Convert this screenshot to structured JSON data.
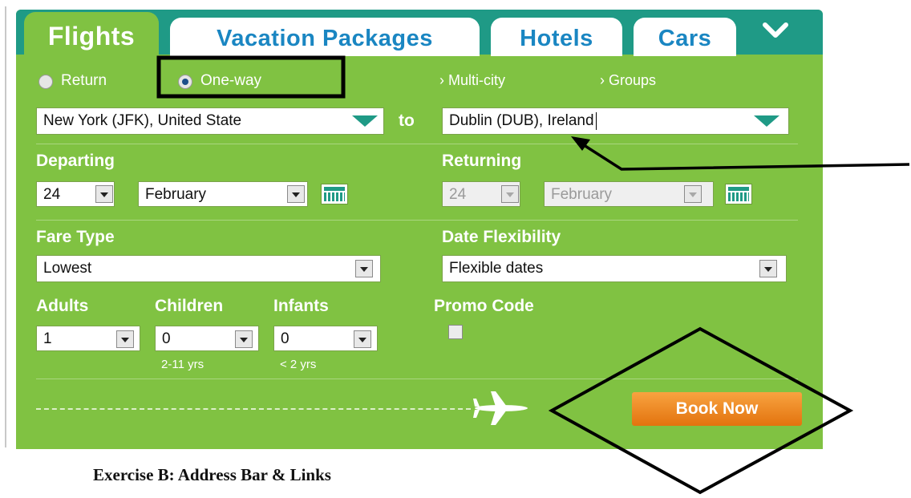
{
  "tabs": [
    {
      "label": "Flights",
      "active": true
    },
    {
      "label": "Vacation Packages",
      "active": false
    },
    {
      "label": "Hotels",
      "active": false
    },
    {
      "label": "Cars",
      "active": false
    }
  ],
  "more_icon": "chevron-down-icon",
  "trip_type": {
    "return_label": "Return",
    "oneway_label": "One-way",
    "selected": "One-way",
    "multicity_link": "Multi-city",
    "groups_link": "Groups"
  },
  "route": {
    "from_value": "New York (JFK), United State",
    "to_label": "to",
    "to_value": "Dublin (DUB), Ireland"
  },
  "departing": {
    "label": "Departing",
    "day": "24",
    "month": "February"
  },
  "returning": {
    "label": "Returning",
    "day": "24",
    "month": "February",
    "disabled": true
  },
  "fare": {
    "label": "Fare Type",
    "value": "Lowest"
  },
  "flex": {
    "label": "Date Flexibility",
    "value": "Flexible dates"
  },
  "passengers": {
    "adults_label": "Adults",
    "adults_value": "1",
    "children_label": "Children",
    "children_value": "0",
    "children_note": "2-11 yrs",
    "infants_label": "Infants",
    "infants_value": "0",
    "infants_note": "< 2 yrs"
  },
  "promo": {
    "label": "Promo Code",
    "checked": false
  },
  "book_label": "Book Now",
  "footer_heading": "Exercise B: Address Bar & Links",
  "colors": {
    "panel_green": "#80c242",
    "tab_bar_teal": "#1f9a86",
    "tab_text_blue": "#1a86c2",
    "book_orange": "#f08c1e",
    "annotation_black": "#000000"
  }
}
